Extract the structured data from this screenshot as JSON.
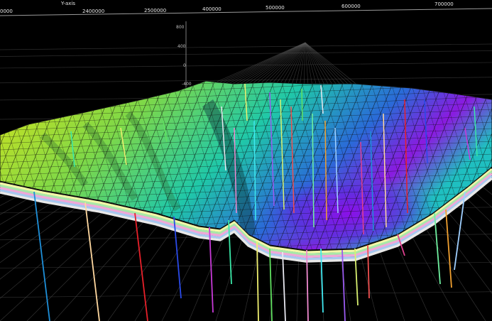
{
  "axes": {
    "axis_title": "Y-axis",
    "top_ticks": [
      "0000",
      "2400000",
      "2500000",
      "400000",
      "500000",
      "600000",
      "700000"
    ],
    "z_ticks": [
      "800",
      "400",
      "0",
      "-400"
    ]
  },
  "colors": {
    "background": "#000000",
    "grid": "#5a5a5a",
    "surface_high": "#d6e21a",
    "surface_mid": "#20c8a8",
    "surface_low": "#8a1ae0",
    "mesh": "#0c0c0c"
  },
  "wells": [
    {
      "color": "#1e8fd8"
    },
    {
      "color": "#ffd8a0"
    },
    {
      "color": "#e8202a"
    },
    {
      "color": "#2a4ae8"
    },
    {
      "color": "#c83ad8"
    },
    {
      "color": "#3ae8a8"
    },
    {
      "color": "#f0f070"
    },
    {
      "color": "#60e060"
    },
    {
      "color": "#e8e8f0"
    },
    {
      "color": "#f08ad0"
    },
    {
      "color": "#40e8f0"
    },
    {
      "color": "#9a5af0"
    },
    {
      "color": "#d8f070"
    },
    {
      "color": "#f05050"
    },
    {
      "color": "#70f0a0"
    },
    {
      "color": "#f0a030"
    },
    {
      "color": "#a0d0ff"
    },
    {
      "color": "#e04090"
    }
  ]
}
